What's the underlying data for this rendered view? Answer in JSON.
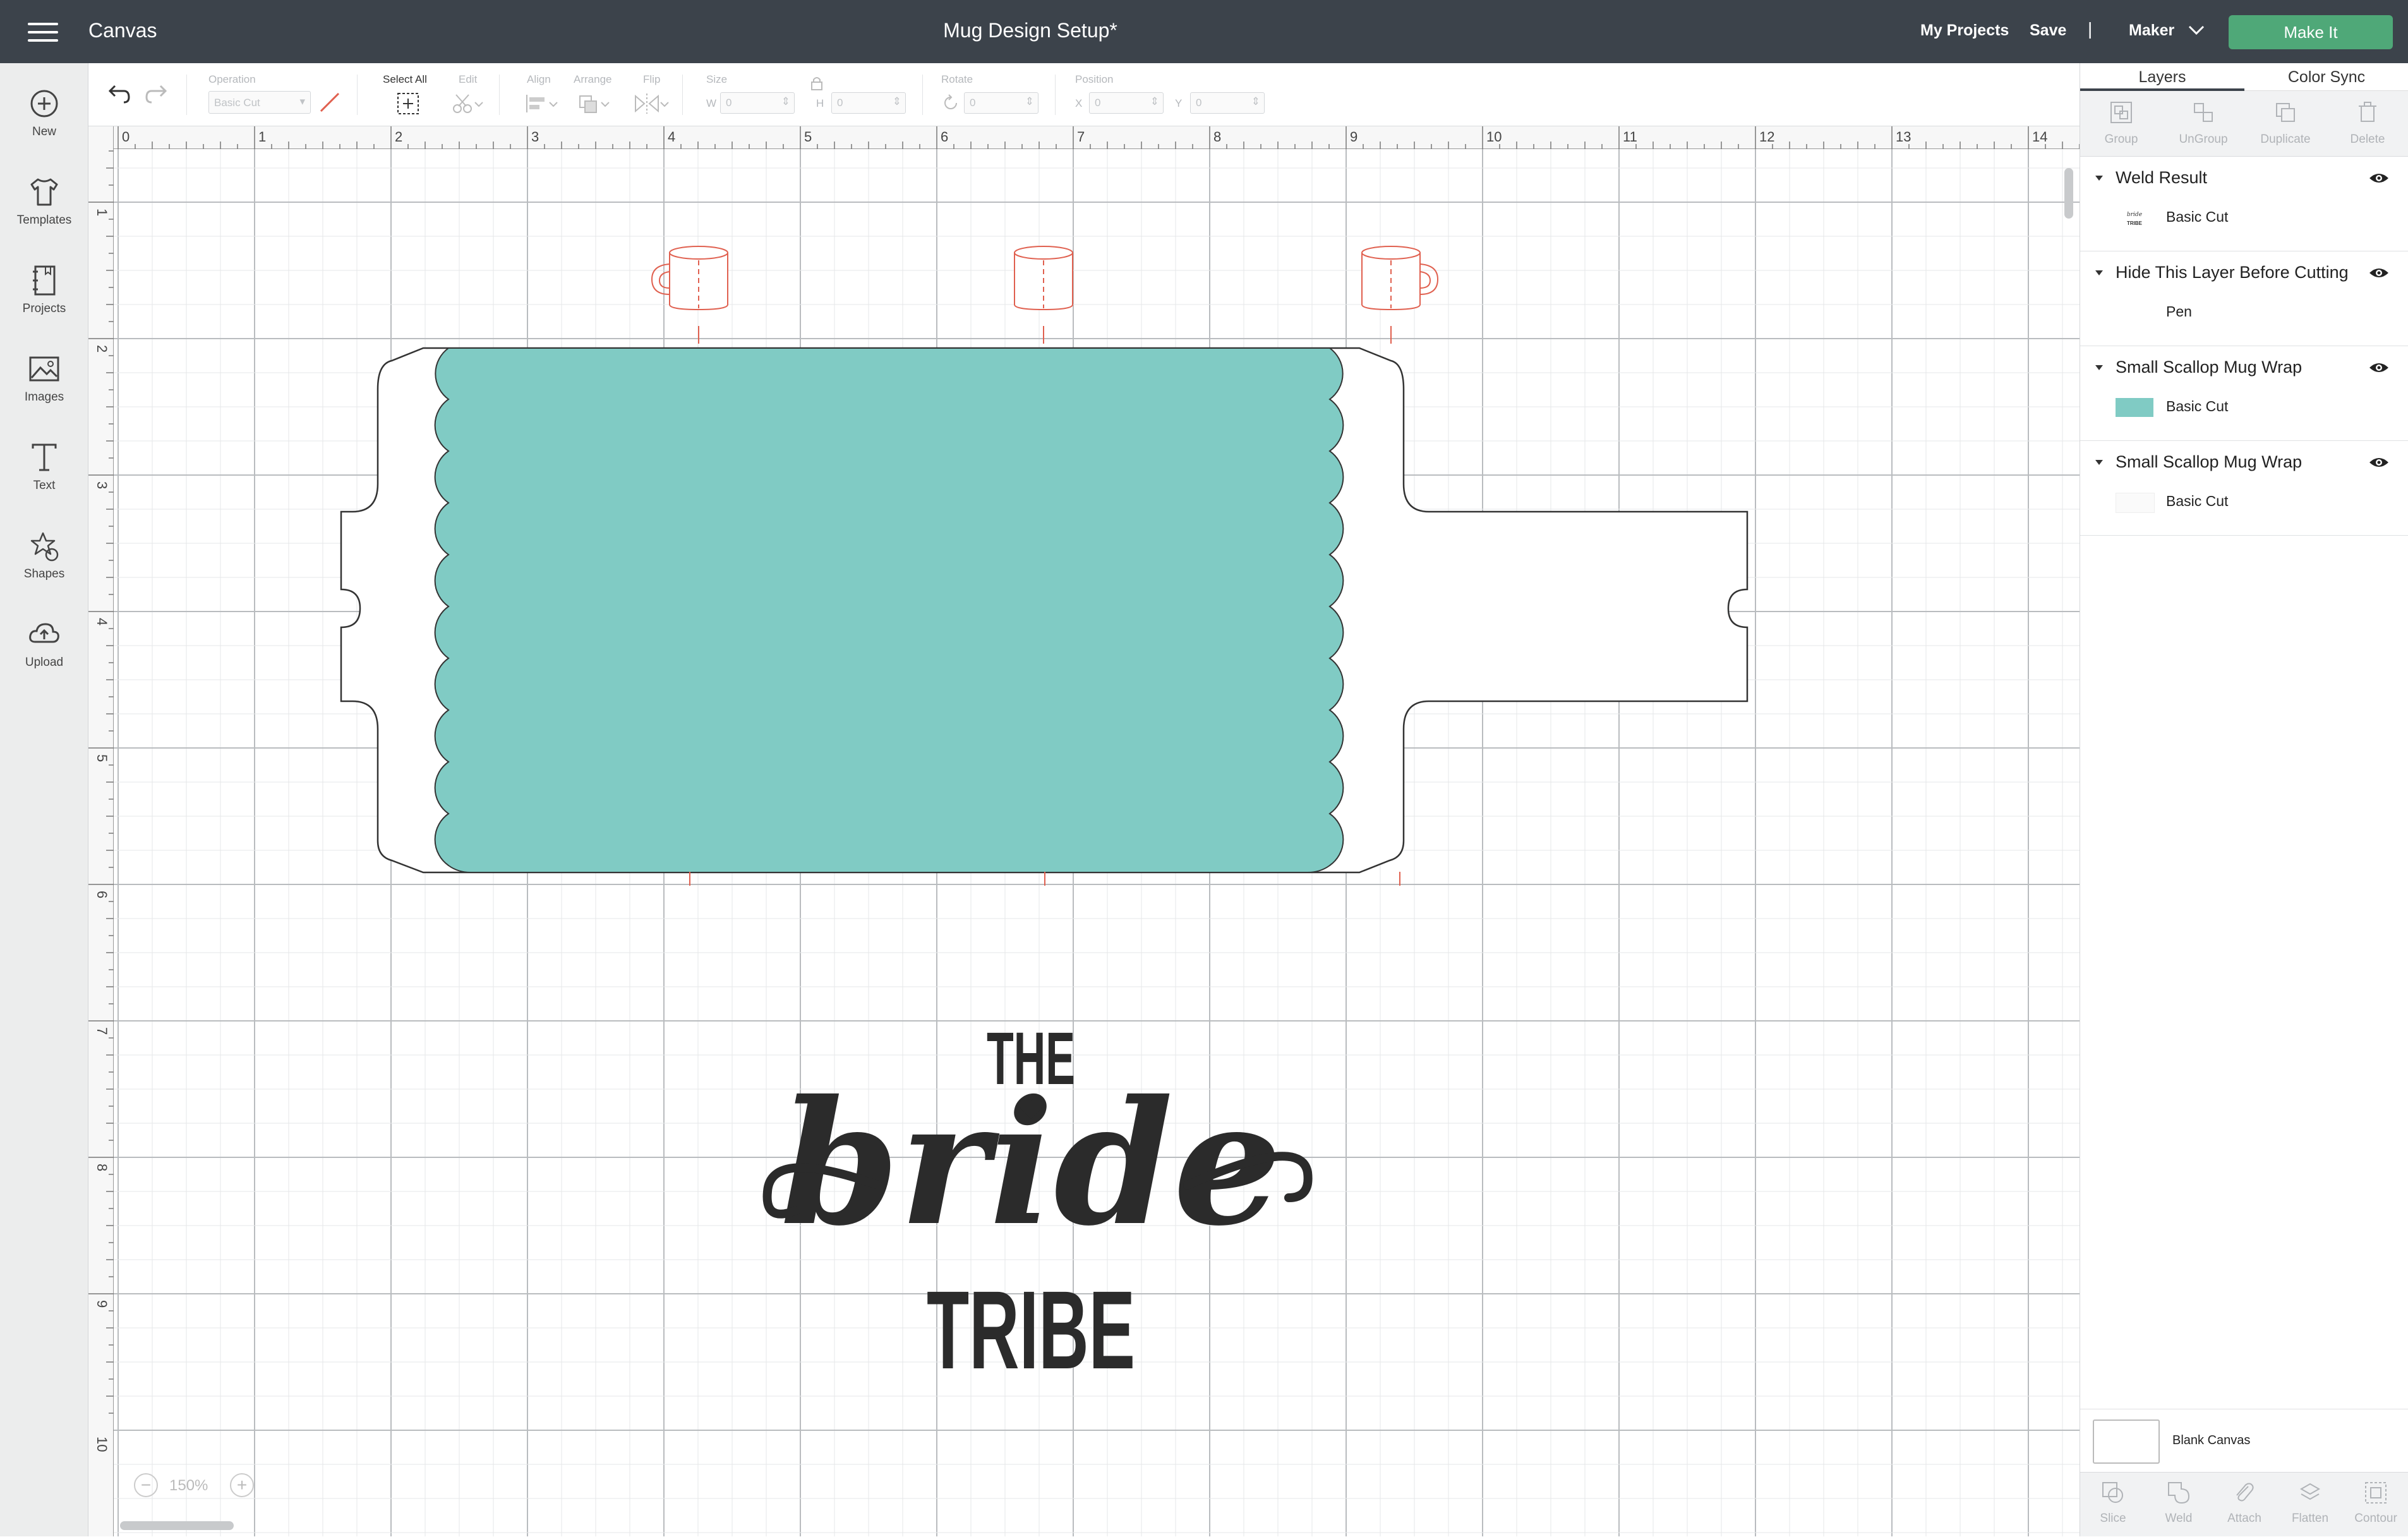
{
  "header": {
    "app_title": "Canvas",
    "document_title": "Mug Design Setup*",
    "my_projects": "My Projects",
    "save": "Save",
    "separator": "|",
    "machine": "Maker",
    "make_it": "Make It",
    "make_it_color": "#4fa878",
    "bar_color": "#3c434b"
  },
  "sidebar": {
    "items": [
      {
        "label": "New",
        "icon": "plus-circle-icon"
      },
      {
        "label": "Templates",
        "icon": "tshirt-icon"
      },
      {
        "label": "Projects",
        "icon": "notebook-icon"
      },
      {
        "label": "Images",
        "icon": "image-icon"
      },
      {
        "label": "Text",
        "icon": "text-t-icon"
      },
      {
        "label": "Shapes",
        "icon": "shapes-icon"
      },
      {
        "label": "Upload",
        "icon": "cloud-upload-icon"
      }
    ]
  },
  "toolbar": {
    "operation_label": "Operation",
    "operation_value": "Basic Cut",
    "select_all": "Select All",
    "edit": "Edit",
    "align": "Align",
    "arrange": "Arrange",
    "flip": "Flip",
    "size": "Size",
    "w_label": "W",
    "w_value": "0",
    "h_label": "H",
    "h_value": "0",
    "rotate": "Rotate",
    "rotate_value": "0",
    "position": "Position",
    "x_label": "X",
    "x_value": "0",
    "y_label": "Y",
    "y_value": "0"
  },
  "rulers": {
    "top": [
      "0",
      "1",
      "2",
      "3",
      "4",
      "5",
      "6",
      "7",
      "8",
      "9",
      "10",
      "11",
      "12",
      "13",
      "14"
    ],
    "left": [
      "1",
      "2",
      "3",
      "4",
      "5",
      "6",
      "7",
      "8",
      "9",
      "10"
    ]
  },
  "canvas": {
    "wrap_color": "#80cbc4",
    "guide_color": "#e0604f",
    "design_text": [
      "THE",
      "bride",
      "TRIBE"
    ],
    "zoom": "150%",
    "zoom_out": "−",
    "zoom_in": "+"
  },
  "panel": {
    "tabs": [
      "Layers",
      "Color Sync"
    ],
    "tools": [
      "Group",
      "UnGroup",
      "Duplicate",
      "Delete"
    ],
    "layers": [
      {
        "name": "Weld Result",
        "op": "Basic Cut",
        "thumb": "bride-tribe-thumb"
      },
      {
        "name": "Hide This Layer Before Cutting",
        "op": "Pen",
        "thumb": "blank-thumb"
      },
      {
        "name": "Small Scallop Mug Wrap",
        "op": "Basic Cut",
        "thumb": "teal-swatch",
        "color": "#80cbc4"
      },
      {
        "name": "Small Scallop Mug Wrap",
        "op": "Basic Cut",
        "thumb": "white-swatch"
      }
    ],
    "blank_canvas": "Blank Canvas",
    "bottom_tools": [
      "Slice",
      "Weld",
      "Attach",
      "Flatten",
      "Contour"
    ]
  }
}
